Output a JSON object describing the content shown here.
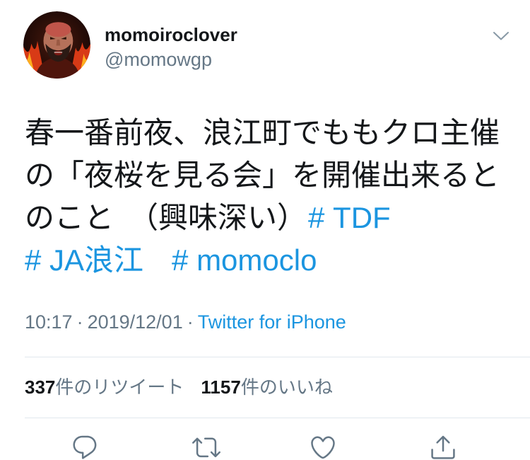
{
  "tweet": {
    "author": {
      "display_name": "momoiroclover",
      "handle": "@momowgp"
    },
    "text_lines": [
      "春一番前夜、浪江町でももクロ主催",
      "の「夜桜を見る会」を開催出来ると",
      "のこと　（興味深い）"
    ],
    "hashtags": [
      "# TDF",
      "# JA浪江",
      "# momoclo"
    ],
    "meta": {
      "time": "10:17",
      "separator": "·",
      "date": "2019/12/01",
      "source": "Twitter for iPhone"
    },
    "stats": {
      "retweet_count": "337",
      "retweet_label": "件のリツイート",
      "like_count": "1157",
      "like_label": "件のいいね"
    }
  },
  "icons": {
    "menu": "chevron-down-icon",
    "reply": "reply-icon",
    "retweet": "retweet-icon",
    "like": "heart-icon",
    "share": "share-icon"
  },
  "colors": {
    "text": "#14171a",
    "secondary": "#657786",
    "link": "#1b95e0",
    "divider": "#e1e8ed",
    "background": "#ffffff"
  }
}
